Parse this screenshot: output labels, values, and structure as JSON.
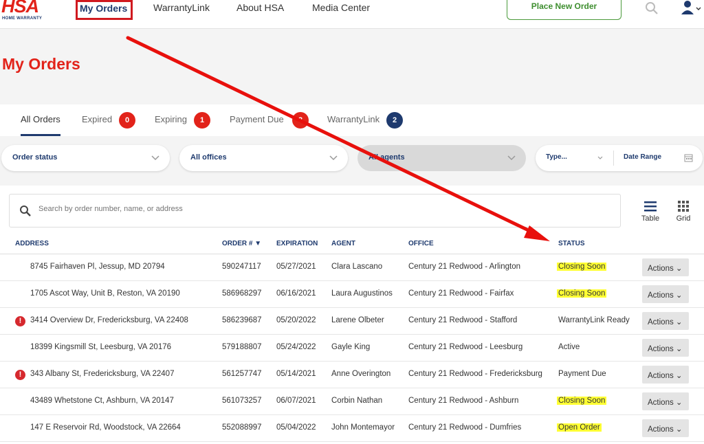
{
  "nav": {
    "logo_text": "HSA",
    "logo_sub": "HOME WARRANTY",
    "links": [
      "My Orders",
      "WarrantyLink",
      "About HSA",
      "Media Center"
    ],
    "place_order": "Place New Order"
  },
  "page_title": "My Orders",
  "tabs": [
    {
      "label": "All Orders"
    },
    {
      "label": "Expired",
      "count": "0"
    },
    {
      "label": "Expiring",
      "count": "1"
    },
    {
      "label": "Payment Due",
      "count": "3"
    },
    {
      "label": "WarrantyLink",
      "count": "2"
    }
  ],
  "filters": {
    "order_status": "Order status",
    "offices": "All offices",
    "agents": "All agents",
    "type": "Type...",
    "date_range": "Date Range"
  },
  "search": {
    "placeholder": "Search by order number, name, or address"
  },
  "views": {
    "table": "Table",
    "grid": "Grid"
  },
  "table": {
    "headers": {
      "address": "ADDRESS",
      "order": "ORDER #",
      "expiration": "EXPIRATION",
      "agent": "AGENT",
      "office": "OFFICE",
      "status": "STATUS"
    },
    "action_label": "Actions",
    "rows": [
      {
        "address": "8745 Fairhaven Pl, Jessup, MD 20794",
        "order": "590247117",
        "expiration": "05/27/2021",
        "agent": "Clara Lascano",
        "office": "Century 21 Redwood - Arlington",
        "status": "Closing Soon"
      },
      {
        "address": "1705 Ascot Way, Unit B, Reston, VA 20190",
        "order": "586968297",
        "expiration": "06/16/2021",
        "agent": "Laura Augustinos",
        "office": "Century 21 Redwood - Fairfax",
        "status": "Closing Soon"
      },
      {
        "address": "3414 Overview Dr, Fredericksburg, VA 22408",
        "order": "586239687",
        "expiration": "05/20/2022",
        "agent": "Larene Olbeter",
        "office": "Century 21 Redwood - Stafford",
        "status": "WarrantyLink Ready"
      },
      {
        "address": "18399 Kingsmill St, Leesburg, VA 20176",
        "order": "579188807",
        "expiration": "05/24/2022",
        "agent": "Gayle King",
        "office": "Century 21 Redwood - Leesburg",
        "status": "Active"
      },
      {
        "address": "343 Albany St, Fredericksburg, VA 22407",
        "order": "561257747",
        "expiration": "05/14/2021",
        "agent": "Anne Overington",
        "office": "Century 21 Redwood - Fredericksburg",
        "status": "Payment Due"
      },
      {
        "address": "43489 Whetstone Ct, Ashburn, VA 20147",
        "order": "561073257",
        "expiration": "06/07/2021",
        "agent": "Corbin Nathan",
        "office": "Century 21 Redwood - Ashburn",
        "status": "Closing Soon"
      },
      {
        "address": "147 E Reservoir Rd, Woodstock, VA 22664",
        "order": "552088997",
        "expiration": "05/04/2022",
        "agent": "John Montemayor",
        "office": "Century 21 Redwood - Dumfries",
        "status": "Open Order"
      }
    ]
  },
  "colors": {
    "brand_red": "#e2231a",
    "navy": "#1e3a6e",
    "highlight": "#ffff33",
    "green": "#3e8e2f"
  }
}
